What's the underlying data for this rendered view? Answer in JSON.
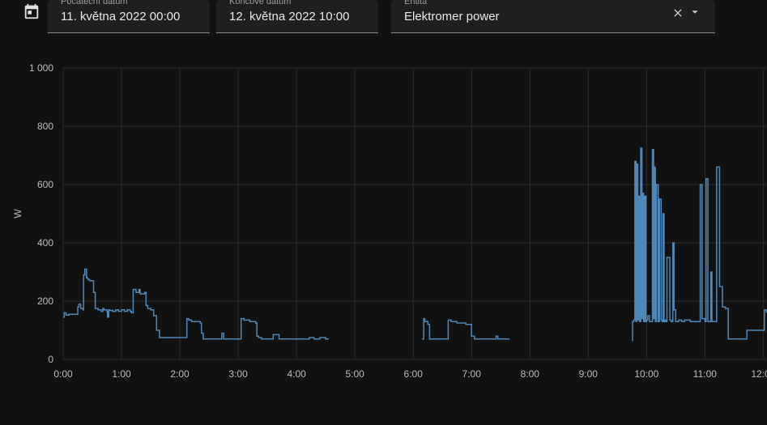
{
  "filters": {
    "start": {
      "label": "Počáteční datum",
      "value": "11. května 2022 00:00"
    },
    "end": {
      "label": "Koncové datum",
      "value": "12. května 2022 10:00"
    },
    "entity": {
      "label": "Entita",
      "value": "Elektromer power"
    }
  },
  "icons": {
    "calendar": "calendar-icon",
    "clear": "close-icon",
    "dropdown": "arrow-drop-down-icon"
  },
  "colors": {
    "background": "#111111",
    "series": "#4f87b8",
    "grid": "#2e2e2e"
  },
  "chart_data": {
    "type": "line",
    "ylabel": "W",
    "ylim": [
      0,
      1000
    ],
    "xlim": [
      0,
      12.05
    ],
    "y_ticks": [
      0,
      200,
      400,
      600,
      800,
      1000
    ],
    "y_tick_labels": [
      "0",
      "200",
      "400",
      "600",
      "800",
      "1 000"
    ],
    "x_ticks": [
      0,
      1,
      2,
      3,
      4,
      5,
      6,
      7,
      8,
      9,
      10,
      11,
      12
    ],
    "x_tick_labels": [
      "0:00",
      "1:00",
      "2:00",
      "3:00",
      "4:00",
      "5:00",
      "6:00",
      "7:00",
      "8:00",
      "9:00",
      "10:00",
      "11:00",
      "12:00"
    ],
    "grid": true,
    "series": [
      {
        "segments": [
          {
            "x": [
              0,
              0.02,
              0.05,
              0.1,
              0.2,
              0.25,
              0.27,
              0.3,
              0.34,
              0.35,
              0.37,
              0.4,
              0.42,
              0.45,
              0.5,
              0.52,
              0.55,
              0.6,
              0.65,
              0.68,
              0.7,
              0.75,
              0.76,
              0.78,
              0.8,
              0.85,
              0.9,
              0.95,
              1.0,
              1.05,
              1.1,
              1.15,
              1.17,
              1.2,
              1.25,
              1.3,
              1.32,
              1.35,
              1.4,
              1.42,
              1.45,
              1.5,
              1.55,
              1.6,
              1.65,
              1.7,
              1.75,
              1.8,
              1.9,
              2.0,
              2.1,
              2.12,
              2.15,
              2.2,
              2.3,
              2.35,
              2.37,
              2.4,
              2.5,
              2.6,
              2.7,
              2.72,
              2.75,
              2.8,
              2.9,
              3.0,
              3.02,
              3.05,
              3.1,
              3.2,
              3.3,
              3.32,
              3.35,
              3.4,
              3.5,
              3.6,
              3.7,
              3.8,
              3.85,
              3.9,
              4.0,
              4.1,
              4.2,
              4.22,
              4.3,
              4.4,
              4.5,
              4.55
            ],
            "y": [
              145,
              160,
              152,
              155,
              155,
              180,
              190,
              175,
              170,
              290,
              310,
              280,
              275,
              270,
              270,
              230,
              175,
              170,
              165,
              175,
              170,
              165,
              145,
              170,
              168,
              165,
              170,
              165,
              170,
              165,
              170,
              165,
              160,
              240,
              230,
              240,
              225,
              225,
              230,
              185,
              175,
              170,
              150,
              100,
              75,
              75,
              75,
              75,
              75,
              75,
              75,
              140,
              135,
              130,
              130,
              125,
              90,
              70,
              70,
              70,
              70,
              90,
              70,
              70,
              70,
              70,
              70,
              140,
              135,
              130,
              125,
              80,
              75,
              70,
              70,
              85,
              70,
              70,
              70,
              70,
              70,
              70,
              70,
              75,
              70,
              75,
              70,
              70
            ]
          },
          {
            "x": [
              6.15,
              6.18,
              6.2,
              6.25,
              6.28,
              6.3,
              6.35,
              6.4,
              6.5,
              6.55,
              6.6,
              6.65,
              6.7,
              6.75,
              6.8,
              6.85,
              6.9,
              7.0,
              7.05,
              7.1,
              7.2,
              7.3,
              7.4,
              7.42,
              7.45,
              7.5,
              7.6,
              7.65
            ],
            "y": [
              70,
              140,
              130,
              120,
              70,
              70,
              70,
              70,
              70,
              70,
              135,
              130,
              130,
              125,
              125,
              125,
              120,
              80,
              70,
              70,
              70,
              70,
              70,
              80,
              70,
              70,
              70,
              70
            ]
          },
          {
            "x": [
              9.75,
              9.76,
              9.78,
              9.8,
              9.82,
              9.83,
              9.85,
              9.86,
              9.88,
              9.9,
              9.92,
              9.94,
              9.95,
              9.97,
              9.99,
              10.0,
              10.02,
              10.05,
              10.08,
              10.1,
              10.12,
              10.13,
              10.15,
              10.17,
              10.2,
              10.22,
              10.25,
              10.27,
              10.28,
              10.3,
              10.32,
              10.34,
              10.35,
              10.4,
              10.42,
              10.45,
              10.47,
              10.5,
              10.52,
              10.55,
              10.6,
              10.62,
              10.65,
              10.7,
              10.75,
              10.8,
              10.85,
              10.9,
              10.92,
              10.95,
              11.0,
              11.02,
              11.05,
              11.1,
              11.12,
              11.15,
              11.2,
              11.25,
              11.3,
              11.35,
              11.4,
              11.5,
              11.6,
              11.7,
              11.72,
              11.8,
              11.9,
              12.0,
              12.02,
              12.05
            ],
            "y": [
              65,
              130,
              135,
              680,
              130,
              670,
              135,
              560,
              130,
              725,
              140,
              570,
              130,
              560,
              130,
              135,
              150,
              130,
              130,
              720,
              140,
              660,
              130,
              600,
              130,
              550,
              135,
              130,
              500,
              130,
              135,
              130,
              350,
              135,
              130,
              400,
              170,
              130,
              130,
              135,
              130,
              130,
              135,
              135,
              130,
              130,
              130,
              130,
              600,
              140,
              130,
              620,
              130,
              300,
              130,
              130,
              660,
              250,
              180,
              175,
              70,
              70,
              70,
              70,
              100,
              100,
              100,
              100,
              170,
              160
            ]
          }
        ]
      }
    ]
  }
}
